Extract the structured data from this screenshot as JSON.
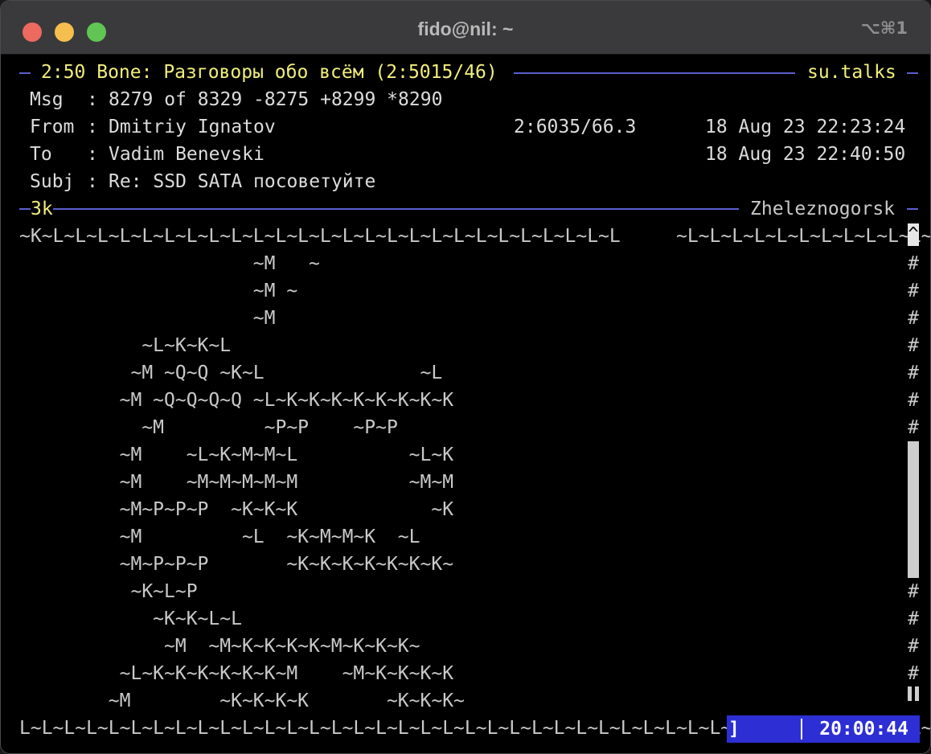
{
  "window": {
    "title": "fido@nil: ~",
    "shortcut": "⌥⌘1"
  },
  "header": {
    "area_line": "2:50 Bone: Разговоры обо всём (2:5015/46)",
    "echo_name": "su.talks",
    "msg_label": "Msg",
    "msg_value": "8279 of 8329 -8275 +8299 *8290",
    "from_label": "From",
    "from_name": "Dmitriy Ignatov",
    "from_address": "2:6035/66.3",
    "from_date": "18 Aug 23 22:23:24",
    "to_label": "To",
    "to_name": "Vadim Benevski",
    "to_date": "18 Aug 23 22:40:50",
    "subj_label": "Subj",
    "subj_value": "Re: SSD SATA посоветуйте",
    "size": "3k",
    "origin_city": "Zheleznogorsk"
  },
  "body_lines": [
    "~K~L~L~L~L~L~L~L~L~L~L~L~L~L~L~L~L~L~L~L~L~L~L~L~L~L~L     ~L~L~L~L~L~L~L~L~L~L~L~L~L~",
    "                     ~M   ~",
    "                     ~M ~",
    "                     ~M",
    "           ~L~K~K~L",
    "          ~M ~Q~Q ~K~L              ~L",
    "         ~M ~Q~Q~Q~Q ~L~K~K~K~K~K~K~K~K",
    "           ~M         ~P~P    ~P~P",
    "         ~M    ~L~K~M~M~L          ~L~K",
    "         ~M    ~M~M~M~M~M          ~M~M",
    "         ~M~P~P~P  ~K~K~K            ~K",
    "         ~M         ~L  ~K~M~M~K  ~L",
    "         ~M~P~P~P       ~K~K~K~K~K~K~K~",
    "          ~K~L~P",
    "            ~K~K~L~L",
    "             ~M  ~M~K~K~K~K~M~K~K~K~",
    "         ~L~K~K~K~K~K~K~M    ~M~K~K~K~K",
    "        ~M        ~K~K~K~K       ~K~K~K~",
    "L~L~L~L~L~L~L~L~L~L~L~L~L~L~L~L~L~L~L~L~L~L~L~L~L~L~L~L~L~L~L~L~L~L~L~L~L~L~L~L~L~K"
  ],
  "scrollbar": {
    "up_arrow": "^",
    "track_char": "#",
    "position": 0.55
  },
  "status": {
    "indicator": "]",
    "clock": "20:00:44"
  },
  "colors": {
    "header_yellow": "#f2ee7c",
    "rule_blue": "#5b5fd0",
    "status_blue": "#2d2fd4",
    "text_gray": "#c9c9c9"
  }
}
